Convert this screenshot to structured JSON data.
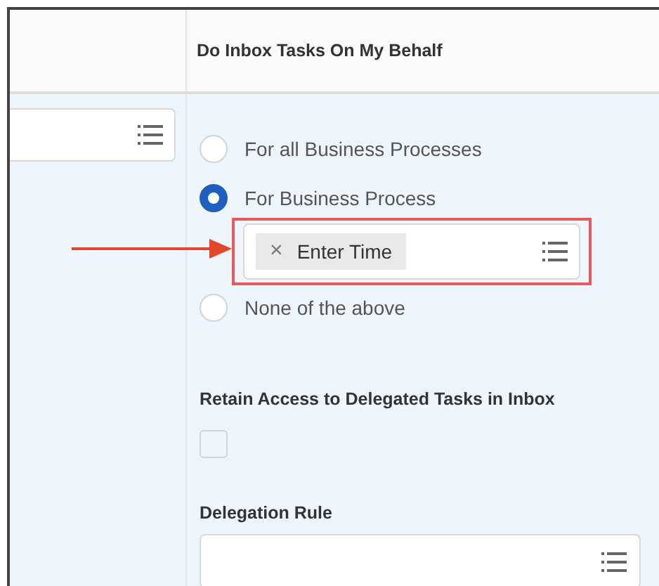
{
  "header": {
    "title": "Do Inbox Tasks On My Behalf"
  },
  "options": [
    {
      "label": "For all Business Processes",
      "selected": false
    },
    {
      "label": "For Business Process",
      "selected": true,
      "selected_items": [
        {
          "label": "Enter Time",
          "remove": "×"
        }
      ],
      "highlighted": true
    },
    {
      "label": "None of the above",
      "selected": false
    }
  ],
  "retain_access": {
    "label": "Retain Access to Delegated Tasks in Inbox",
    "checked": false
  },
  "delegation_rule": {
    "label": "Delegation Rule"
  }
}
